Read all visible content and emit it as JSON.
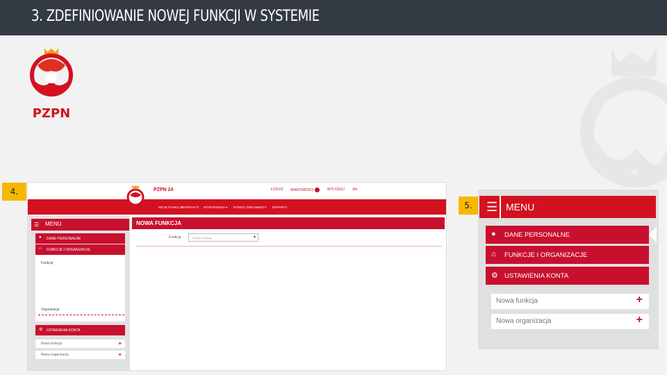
{
  "slide": {
    "title": "3. ZDEFINIOWANIE NOWEJ FUNKCJI W SYSTEMIE",
    "logo_text": "PZPN"
  },
  "markers": {
    "step4": "4.",
    "step5": "5."
  },
  "screenshot4": {
    "brand": "PZPN 24",
    "top_nav": {
      "item1": "ŁOSVIZ",
      "item2": "WIADOMOŚCI",
      "messages_badge": "1",
      "logout": "WYLOGUJ"
    },
    "main_nav": [
      "MOJE FUNKCJE",
      "KONTAKTY",
      "WYDARZENIA ▾",
      "PONOC DOKUMENTY",
      "DEPARTY"
    ],
    "menu_label": "MENU",
    "sidebar_items": [
      "DANE PERSONALNE",
      "FUNKCJE I ORGANIZACJE"
    ],
    "sub_list": [
      "Funkcje",
      "Organizacje"
    ],
    "account_item": "USTAWIENIA KONTA",
    "quick_links": [
      "Nowa funkcja",
      "Nowa organizacja"
    ],
    "content_title": "NOWA FUNKCJA",
    "field_label": "Funkcja",
    "select_placeholder": "Wybierz funkcję"
  },
  "screenshot5": {
    "menu_label": "MENU",
    "items": [
      "DANE PERSONALNE",
      "FUNKCJE I ORGANIZACJE",
      "USTAWIENIA KONTA"
    ],
    "quick_links": [
      "Nowa funkcja",
      "Nowa organizacja"
    ]
  },
  "colors": {
    "brand_red": "#c8102e",
    "header_dark": "#333a44",
    "marker_yellow": "#f6b700"
  },
  "icons": [
    "user-icon",
    "bank-icon",
    "gear-icon",
    "hamburger-icon",
    "plus-icon"
  ]
}
